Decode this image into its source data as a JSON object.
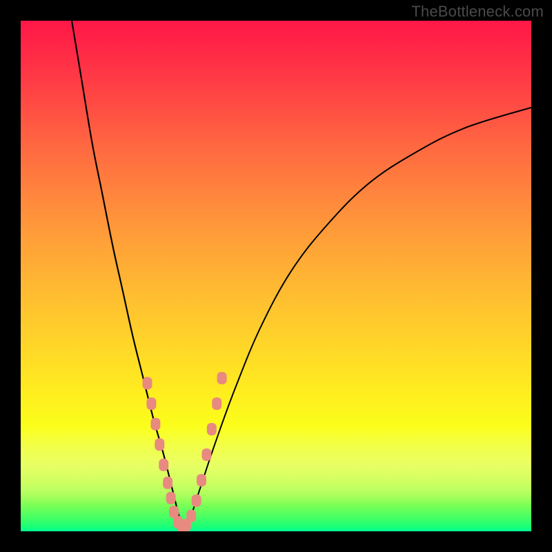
{
  "attribution": "TheBottleneck.com",
  "colors": {
    "frame": "#000000",
    "curve_stroke": "#000000",
    "dot_fill": "#e88a80",
    "dot_stroke": "#c86a60",
    "gradient_top": "#ff1747",
    "gradient_bottom": "#00ff94"
  },
  "chart_data": {
    "type": "line",
    "title": "",
    "xlabel": "",
    "ylabel": "",
    "xlim": [
      0,
      100
    ],
    "ylim": [
      0,
      100
    ],
    "legend": false,
    "grid": false,
    "axes_visible": false,
    "series": [
      {
        "name": "left-curve",
        "x": [
          10,
          12,
          14,
          16,
          18,
          20,
          22,
          24,
          26,
          28,
          30,
          31,
          32
        ],
        "y": [
          100,
          88,
          76,
          66,
          56,
          47,
          38,
          30,
          22,
          15,
          7,
          3,
          0.5
        ]
      },
      {
        "name": "right-curve",
        "x": [
          32,
          33,
          35,
          38,
          42,
          47,
          53,
          60,
          68,
          77,
          87,
          100
        ],
        "y": [
          0.5,
          2,
          8,
          17,
          28,
          40,
          51,
          60,
          68,
          74,
          79,
          83
        ]
      }
    ],
    "annotations": [],
    "dots": {
      "name": "marker-dots",
      "x": [
        24.8,
        25.6,
        26.4,
        27.2,
        28.0,
        28.8,
        29.4,
        30.0,
        30.8,
        31.6,
        32.4,
        33.4,
        34.4,
        35.4,
        36.4,
        37.4,
        38.4,
        39.4
      ],
      "y": [
        29.0,
        25.0,
        21.0,
        17.0,
        13.0,
        9.5,
        6.5,
        3.8,
        1.8,
        1.0,
        1.2,
        3.0,
        6.0,
        10.0,
        15.0,
        20.0,
        25.0,
        30.0
      ]
    }
  }
}
